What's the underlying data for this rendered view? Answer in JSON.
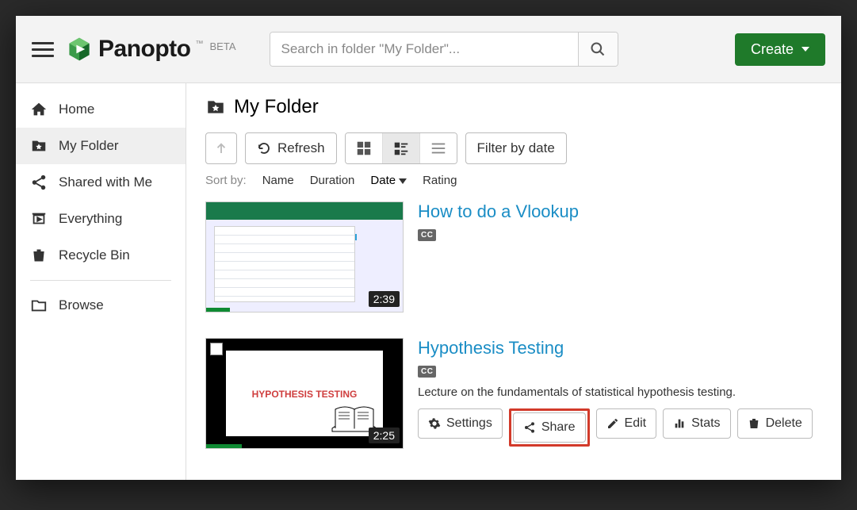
{
  "header": {
    "brand": "Panopto",
    "beta_label": "BETA",
    "search_placeholder": "Search in folder \"My Folder\"...",
    "create_label": "Create"
  },
  "sidebar": {
    "items": [
      {
        "label": "Home"
      },
      {
        "label": "My Folder"
      },
      {
        "label": "Shared with Me"
      },
      {
        "label": "Everything"
      },
      {
        "label": "Recycle Bin"
      }
    ],
    "browse_label": "Browse"
  },
  "main": {
    "page_title": "My Folder",
    "toolbar": {
      "refresh_label": "Refresh",
      "filter_label": "Filter by date"
    },
    "sort": {
      "label": "Sort by:",
      "options": [
        "Name",
        "Duration",
        "Date",
        "Rating"
      ],
      "active": "Date"
    },
    "videos": [
      {
        "title": "How to do a Vlookup",
        "cc": "CC",
        "duration": "2:39",
        "description": "",
        "thumb_slide_title": "",
        "progress_pct": 12
      },
      {
        "title": "Hypothesis Testing",
        "cc": "CC",
        "duration": "2:25",
        "description": "Lecture on the fundamentals of statistical hypothesis testing.",
        "thumb_slide_title": "HYPOTHESIS TESTING",
        "progress_pct": 18
      }
    ],
    "actions": {
      "settings": "Settings",
      "share": "Share",
      "edit": "Edit",
      "stats": "Stats",
      "delete": "Delete"
    }
  }
}
